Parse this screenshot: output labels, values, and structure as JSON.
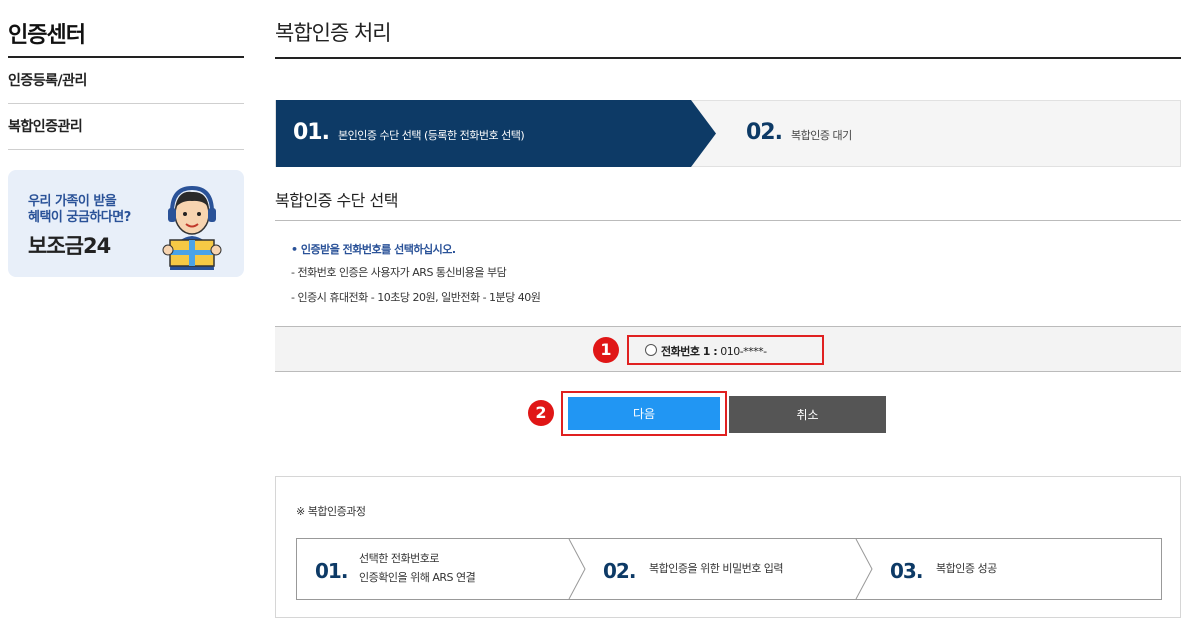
{
  "sidebar": {
    "title": "인증센터",
    "items": [
      {
        "label": "인증등록/관리"
      },
      {
        "label": "복합인증관리"
      }
    ],
    "banner": {
      "line1": "우리 가족이 받을",
      "line2": "혜택이 궁금하다면?",
      "brand": "보조금24"
    }
  },
  "main": {
    "title": "복합인증 처리",
    "steps": [
      {
        "num": "01.",
        "label": "본인인증 수단 선택 (등록한 전화번호 선택)",
        "active": true
      },
      {
        "num": "02.",
        "label": "복합인증 대기",
        "active": false
      }
    ],
    "section_title": "복합인증 수단 선택",
    "notes": {
      "main": "• 인증받을 전화번호를 선택하십시오.",
      "lines": [
        "- 전화번호 인증은 사용자가 ARS 통신비용을 부담",
        "- 인증시 휴대전화 - 10초당 20원, 일반전화 - 1분당 40원"
      ]
    },
    "phone_option": {
      "label": "전화번호 1 :",
      "value": " 010-****-"
    },
    "badges": [
      "1",
      "2"
    ],
    "buttons": {
      "next": "다음",
      "cancel": "취소"
    },
    "process": {
      "title": "※ 복합인증과정",
      "steps": [
        {
          "num": "01.",
          "line1": "선택한 전화번호로",
          "line2": "인증확인을 위해 ARS 연결"
        },
        {
          "num": "02.",
          "line1": "복합인증을 위한 비밀번호 입력"
        },
        {
          "num": "03.",
          "line1": "복합인증 성공"
        }
      ]
    }
  },
  "colors": {
    "navy": "#0d3a66",
    "blue_button": "#2196f3",
    "gray_button": "#555555",
    "highlight_red": "#e02020"
  }
}
